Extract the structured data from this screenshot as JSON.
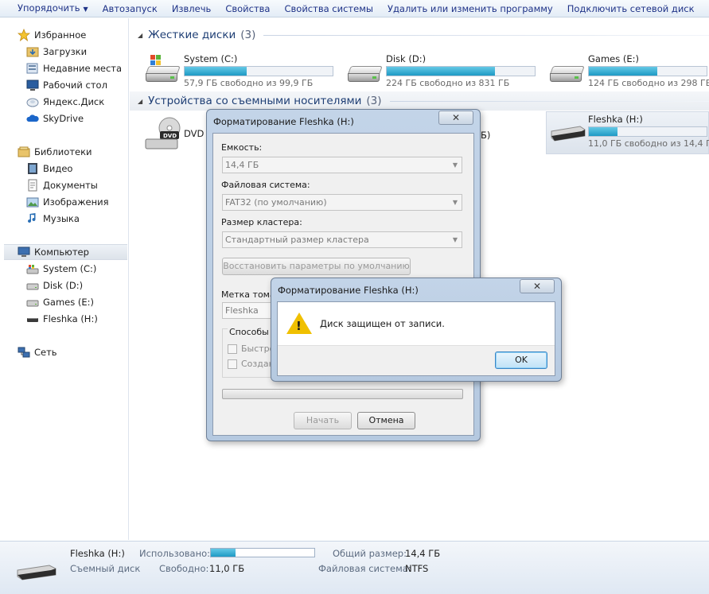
{
  "toolbar": {
    "organize": "Упорядочить",
    "autoplay": "Автозапуск",
    "eject": "Извлечь",
    "properties": "Свойства",
    "system_properties": "Свойства системы",
    "uninstall": "Удалить или изменить программу",
    "map_drive": "Подключить сетевой диск"
  },
  "sidebar": {
    "favorites": {
      "label": "Избранное",
      "items": [
        "Загрузки",
        "Недавние места",
        "Рабочий стол",
        "Яндекс.Диск",
        "SkyDrive"
      ]
    },
    "libraries": {
      "label": "Библиотеки",
      "items": [
        "Видео",
        "Документы",
        "Изображения",
        "Музыка"
      ]
    },
    "computer": {
      "label": "Компьютер",
      "items": [
        "System (C:)",
        "Disk (D:)",
        "Games (E:)",
        "Fleshka (H:)"
      ]
    },
    "network": {
      "label": "Сеть"
    }
  },
  "main": {
    "hdd_group": {
      "title": "Жесткие диски",
      "count": "(3)"
    },
    "removable_group": {
      "title": "Устройства со съемными носителями",
      "count": "(3)"
    },
    "drives": [
      {
        "name": "System (C:)",
        "free": "57,9 ГБ свободно из 99,9 ГБ",
        "used_fraction": 0.42
      },
      {
        "name": "Disk (D:)",
        "free": "224 ГБ свободно из 831 ГБ",
        "used_fraction": 0.73
      },
      {
        "name": "Games (E:)",
        "free": "124 ГБ свободно из 298 ГБ",
        "used_fraction": 0.58
      }
    ],
    "removable": [
      {
        "name": "DVD"
      },
      {
        "name": "Fleshka (H:)",
        "free": "11,0 ГБ свободно из 14,4 ГБ",
        "used_fraction": 0.24
      }
    ],
    "hidden_fragment": "Б)"
  },
  "status": {
    "drive_name": "Fleshka (H:)",
    "drive_type": "Съемный диск",
    "used_label": "Использовано:",
    "used_fraction": 0.24,
    "free_label": "Свободно:",
    "free_value": "11,0 ГБ",
    "total_label": "Общий размер:",
    "total_value": "14,4 ГБ",
    "fs_label": "Файловая система:",
    "fs_value": "NTFS"
  },
  "format_dialog": {
    "title": "Форматирование Fleshka (H:)",
    "close": "✕",
    "capacity_label": "Емкость:",
    "capacity_value": "14,4 ГБ",
    "fs_label": "Файловая система:",
    "fs_value": "FAT32 (по умолчанию)",
    "cluster_label": "Размер кластера:",
    "cluster_value": "Стандартный размер кластера",
    "restore_defaults": "Восстановить параметры по умолчанию",
    "volume_label": "Метка тома:",
    "volume_value": "Fleshka",
    "methods_label": "Способы ф",
    "quick_label": "Быстрое",
    "create_label": "Создань",
    "start": "Начать",
    "cancel": "Отмена"
  },
  "error_dialog": {
    "title": "Форматирование Fleshka (H:)",
    "close": "✕",
    "message": "Диск защищен от записи.",
    "ok": "OK"
  }
}
